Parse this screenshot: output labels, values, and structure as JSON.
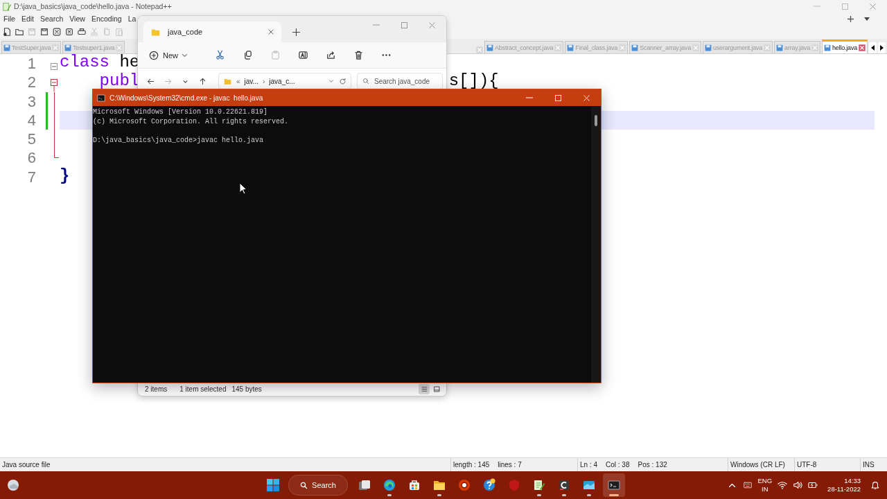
{
  "notepad": {
    "title": "D:\\java_basics\\java_code\\hello.java - Notepad++",
    "menu": [
      "File",
      "Edit",
      "Search",
      "View",
      "Encoding",
      "La"
    ],
    "tab_bar": {
      "left_tabs": [
        {
          "label": "TestSuper.java",
          "selected": false
        },
        {
          "label": "Testsuper1.java",
          "selected": false
        }
      ],
      "right_tabs": [
        {
          "label": "Abstract_concept.java",
          "selected": false
        },
        {
          "label": "Final_class.java",
          "selected": false
        },
        {
          "label": "Scanner_array.java",
          "selected": false
        },
        {
          "label": "userargument.java",
          "selected": false
        },
        {
          "label": "array.java",
          "selected": false
        },
        {
          "label": "hello.java",
          "selected": true
        }
      ]
    },
    "editor": {
      "lines": [
        {
          "number": "1",
          "kind": "fold-start",
          "changed": false,
          "current": false,
          "indented": false,
          "tokens": [
            {
              "kind": "keyword",
              "text": "class"
            },
            {
              "kind": "plain",
              "text": "he"
            }
          ]
        },
        {
          "number": "2",
          "kind": "fold-start-current",
          "changed": false,
          "current": false,
          "indented": true,
          "tokens": [
            {
              "kind": "keyword",
              "text": "publ"
            }
          ],
          "tail": [
            {
              "kind": "plain",
              "text": "s[]){"
            }
          ]
        },
        {
          "number": "3",
          "kind": "fold-body",
          "changed": true,
          "current": false
        },
        {
          "number": "4",
          "kind": "fold-body",
          "changed": true,
          "current": true
        },
        {
          "number": "5",
          "kind": "fold-body",
          "changed": false,
          "current": false
        },
        {
          "number": "6",
          "kind": "fold-end",
          "changed": false,
          "current": false
        },
        {
          "number": "7",
          "kind": "plain",
          "changed": false,
          "current": false,
          "indented": false,
          "tokens": [
            {
              "kind": "brace",
              "text": "}"
            }
          ]
        }
      ]
    },
    "status_bar": {
      "file_type": "Java source file",
      "length": "length : 145",
      "lines": "lines : 7",
      "line": "Ln : 4",
      "column": "Col : 38",
      "position": "Pos : 132",
      "eol": "Windows (CR LF)",
      "encoding": "UTF-8",
      "mode": "INS"
    }
  },
  "explorer": {
    "tab": "java_code",
    "new_button": "New",
    "actions": [
      {
        "kind": "cut",
        "disabled": false
      },
      {
        "kind": "copy",
        "disabled": false
      },
      {
        "kind": "paste",
        "disabled": true
      },
      {
        "kind": "rename",
        "disabled": false
      },
      {
        "kind": "share",
        "disabled": false
      },
      {
        "kind": "delete",
        "disabled": false
      },
      {
        "kind": "more",
        "disabled": false
      }
    ],
    "nav": [
      {
        "kind": "back",
        "disabled": false
      },
      {
        "kind": "forward",
        "disabled": true
      },
      {
        "kind": "recent",
        "disabled": false
      },
      {
        "kind": "up",
        "disabled": false
      }
    ],
    "breadcrumb": [
      {
        "kind": "overflow",
        "text": "«"
      },
      {
        "kind": "folder",
        "text": "jav..."
      },
      {
        "kind": "separator",
        "text": "›"
      },
      {
        "kind": "folder",
        "text": "java_c..."
      }
    ],
    "search": {
      "placeholder": "Search java_code"
    },
    "status_bar": {
      "count": "2 items",
      "selection": "1 item selected",
      "size": "145 bytes"
    },
    "views": [
      {
        "kind": "details",
        "selected": true
      },
      {
        "kind": "tiles",
        "selected": false
      }
    ]
  },
  "cmd": {
    "title": "C:\\Windows\\System32\\cmd.exe - javac  hello.java",
    "output": [
      "Microsoft Windows [Version 10.0.22621.819]",
      "(c) Microsoft Corporation. All rights reserved."
    ],
    "prompt": "D:\\java_basics\\java_code>javac hello.java"
  },
  "taskbar": {
    "search": "Search",
    "apps": [
      {
        "kind": "taskview",
        "running": false,
        "selected": false
      },
      {
        "kind": "browser",
        "running": true,
        "selected": false
      },
      {
        "kind": "store",
        "running": false,
        "selected": false
      },
      {
        "kind": "folder",
        "running": true,
        "selected": false
      },
      {
        "kind": "ring",
        "running": false,
        "selected": false
      },
      {
        "kind": "help",
        "running": false,
        "selected": false
      },
      {
        "kind": "shield",
        "running": false,
        "selected": false
      },
      {
        "kind": "notepad",
        "running": true,
        "selected": false
      },
      {
        "kind": "code",
        "running": true,
        "selected": false
      },
      {
        "kind": "window",
        "running": true,
        "selected": false
      },
      {
        "kind": "terminal",
        "running": true,
        "selected": true
      }
    ],
    "tray": {
      "language": "ENG",
      "region": "IN",
      "time": "14:33",
      "date": "28-11-2022"
    }
  }
}
